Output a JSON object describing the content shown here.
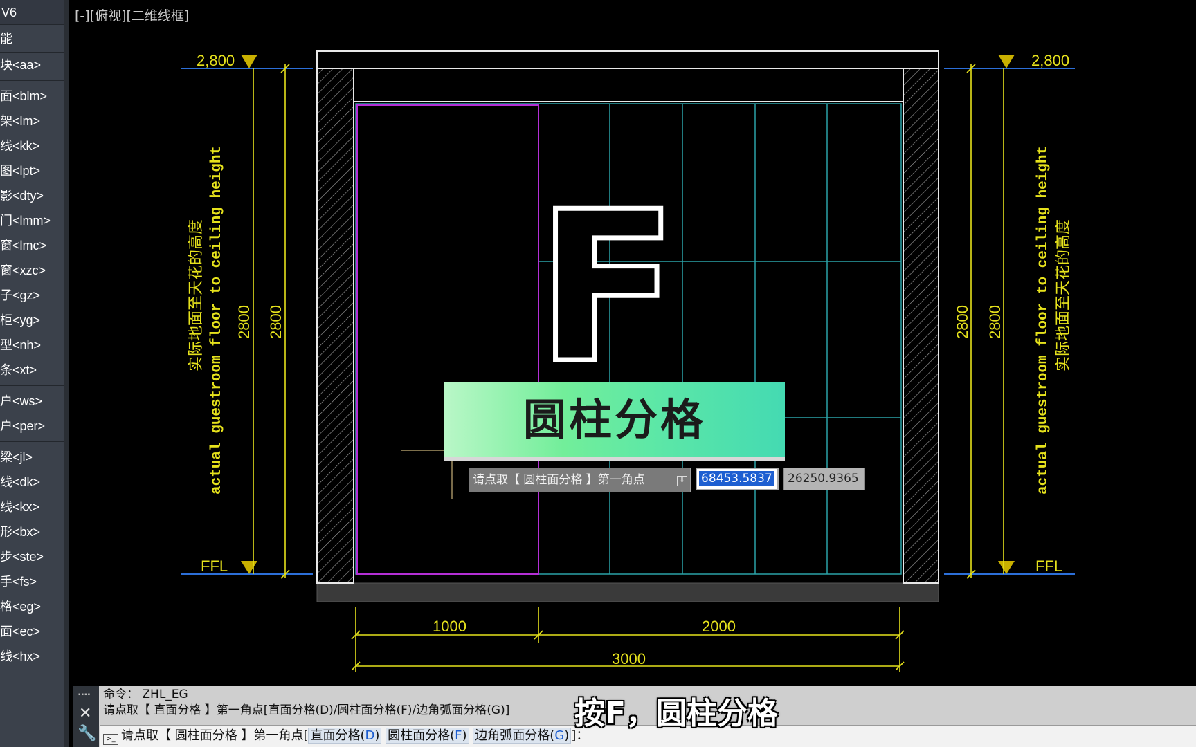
{
  "sidebar": {
    "title": "V6",
    "items": [
      "能",
      "块<aa>",
      "面<blm>",
      "架<lm>",
      "线<kk>",
      "图<lpt>",
      "影<dty>",
      "门<lmm>",
      "窗<lmc>",
      "窗<xzc>",
      "子<gz>",
      "柜<yg>",
      "型<nh>",
      "条<xt>",
      "户<ws>",
      "户<per>",
      "梁<jl>",
      "线<dk>",
      "线<kx>",
      "形<bx>",
      "步<ste>",
      "手<fs>",
      "格<eg>",
      "面<ec>",
      "线<hx>"
    ]
  },
  "viewport_label": "[-][俯视][二维线框]",
  "drawing": {
    "level_top_left": "2,800",
    "level_top_right": "2,800",
    "level_bottom_left": "FFL",
    "level_bottom_right": "FFL",
    "dim_vertical": "2800",
    "annot_en": "actual guestroom floor to ceiling height",
    "annot_cn": "实际地面至天花的高度",
    "dim_1000": "1000",
    "dim_2000": "2000",
    "dim_3000": "3000",
    "big_letter": "F"
  },
  "dynamic_input": {
    "prompt": "请点取【 圆柱面分格 】第一角点",
    "x_value": "68453.5837",
    "y_value": "26250.9365"
  },
  "banner": {
    "text": "圆柱分格"
  },
  "command": {
    "history_line1": "命令： ZHL_EG",
    "history_line2": "请点取【 直面分格 】第一角点[直面分格(D)/圆柱面分格(F)/边角弧面分格(G)]",
    "prompt_prefix": "请点取【 圆柱面分格 】第一角点[",
    "opt1_label": "直面分格(",
    "opt1_key": "D",
    "opt2_label": "圆柱面分格(",
    "opt2_key": "F",
    "opt3_label": "边角弧面分格(",
    "opt3_key": "G",
    "prompt_suffix": "]："
  },
  "subtitle": "按F，圆柱分格",
  "colors": {
    "dimension_yellow": "#e6e21c",
    "grid_cyan": "#2aa3a8",
    "selection_magenta": "#b42fd6",
    "wall_white": "#e8e8e8",
    "banner_green": "#5ee8a6"
  }
}
